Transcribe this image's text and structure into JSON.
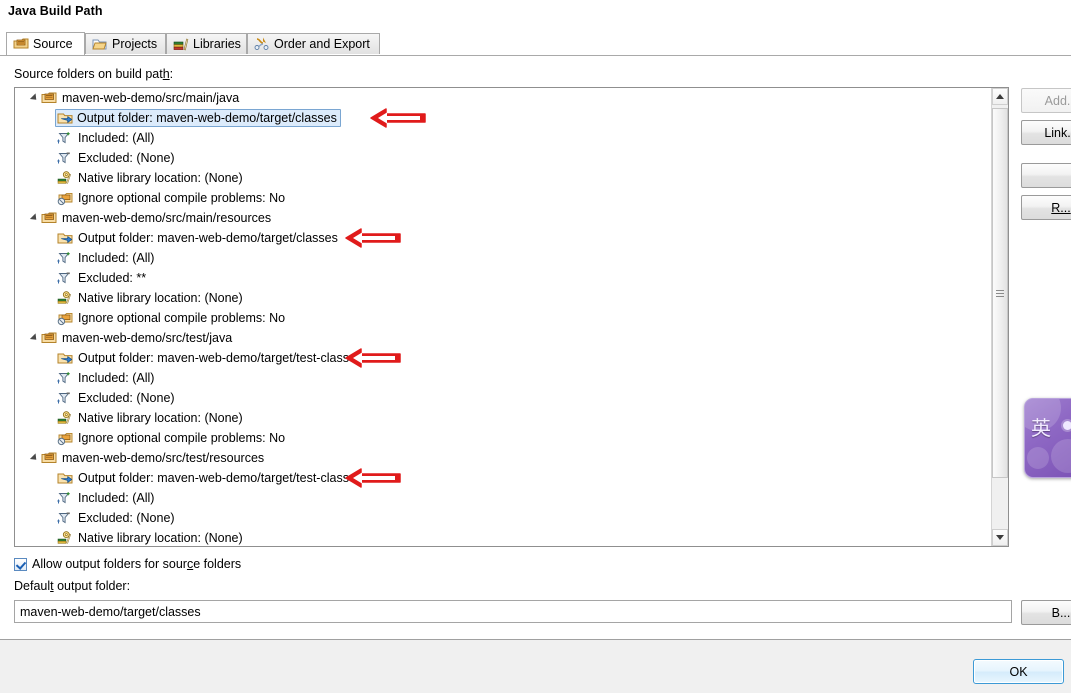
{
  "dialog": {
    "title": "Java Build Path"
  },
  "tabs": [
    {
      "label": "Source",
      "icon": "package-icon",
      "active": true
    },
    {
      "label": "Projects",
      "icon": "folder-open-icon",
      "active": false
    },
    {
      "label": "Libraries",
      "icon": "books-icon",
      "active": false
    },
    {
      "label": "Order and Export",
      "icon": "order-export-icon",
      "active": false
    }
  ],
  "tree": {
    "label_prefix": "Source folders on build pat",
    "label_mnemonic": "h",
    "label_suffix": ":",
    "groups": [
      {
        "name": "maven-web-demo/src/main/java",
        "icon": "source-folder-icon",
        "children": [
          {
            "label": "Output folder: maven-web-demo/target/classes",
            "icon": "output-folder-icon",
            "selected": true,
            "arrow": true
          },
          {
            "label": "Included: (All)",
            "icon": "included-filter-icon",
            "selected": false,
            "arrow": false
          },
          {
            "label": "Excluded: (None)",
            "icon": "excluded-filter-icon",
            "selected": false,
            "arrow": false
          },
          {
            "label": "Native library location: (None)",
            "icon": "native-library-icon",
            "selected": false,
            "arrow": false
          },
          {
            "label": "Ignore optional compile problems: No",
            "icon": "ignore-problems-icon",
            "selected": false,
            "arrow": false
          }
        ]
      },
      {
        "name": "maven-web-demo/src/main/resources",
        "icon": "source-folder-icon",
        "children": [
          {
            "label": "Output folder: maven-web-demo/target/classes",
            "icon": "output-folder-icon",
            "selected": false,
            "arrow": true
          },
          {
            "label": "Included: (All)",
            "icon": "included-filter-icon",
            "selected": false,
            "arrow": false
          },
          {
            "label": "Excluded: **",
            "icon": "excluded-filter-icon",
            "selected": false,
            "arrow": false
          },
          {
            "label": "Native library location: (None)",
            "icon": "native-library-icon",
            "selected": false,
            "arrow": false
          },
          {
            "label": "Ignore optional compile problems: No",
            "icon": "ignore-problems-icon",
            "selected": false,
            "arrow": false
          }
        ]
      },
      {
        "name": "maven-web-demo/src/test/java",
        "icon": "source-folder-icon",
        "children": [
          {
            "label": "Output folder: maven-web-demo/target/test-classes",
            "icon": "output-folder-icon",
            "selected": false,
            "arrow": true
          },
          {
            "label": "Included: (All)",
            "icon": "included-filter-icon",
            "selected": false,
            "arrow": false
          },
          {
            "label": "Excluded: (None)",
            "icon": "excluded-filter-icon",
            "selected": false,
            "arrow": false
          },
          {
            "label": "Native library location: (None)",
            "icon": "native-library-icon",
            "selected": false,
            "arrow": false
          },
          {
            "label": "Ignore optional compile problems: No",
            "icon": "ignore-problems-icon",
            "selected": false,
            "arrow": false
          }
        ]
      },
      {
        "name": "maven-web-demo/src/test/resources",
        "icon": "source-folder-icon",
        "children": [
          {
            "label": "Output folder: maven-web-demo/target/test-classes",
            "icon": "output-folder-icon",
            "selected": false,
            "arrow": true
          },
          {
            "label": "Included: (All)",
            "icon": "included-filter-icon",
            "selected": false,
            "arrow": false
          },
          {
            "label": "Excluded: (None)",
            "icon": "excluded-filter-icon",
            "selected": false,
            "arrow": false
          },
          {
            "label": "Native library location: (None)",
            "icon": "native-library-icon",
            "selected": false,
            "arrow": false
          }
        ]
      }
    ]
  },
  "side_buttons": [
    {
      "label": "Add...",
      "disabled": true
    },
    {
      "label": "Link...",
      "disabled": false
    },
    {
      "label": "",
      "disabled": false
    },
    {
      "label": "R...",
      "disabled": false
    }
  ],
  "options": {
    "allow_output_folders_prefix": "Allow output folders for sour",
    "allow_output_folders_mnemonic": "c",
    "allow_output_folders_suffix": "e folders",
    "allow_output_folders_checked": true,
    "default_output_prefix": "Defaul",
    "default_output_mnemonic": "t",
    "default_output_suffix": " output folder:",
    "default_output_value": "maven-web-demo/target/classes",
    "browse_label": "B..."
  },
  "footer": {
    "ok_label": "OK"
  },
  "ime": {
    "mode_char": "英"
  },
  "colors": {
    "accent": "#3c9ad6",
    "selection_bg": "#dcebfb",
    "selection_border": "#7aa6d2",
    "annotation_red": "#e01b1b",
    "panel_bg": "#f0f0f0"
  }
}
